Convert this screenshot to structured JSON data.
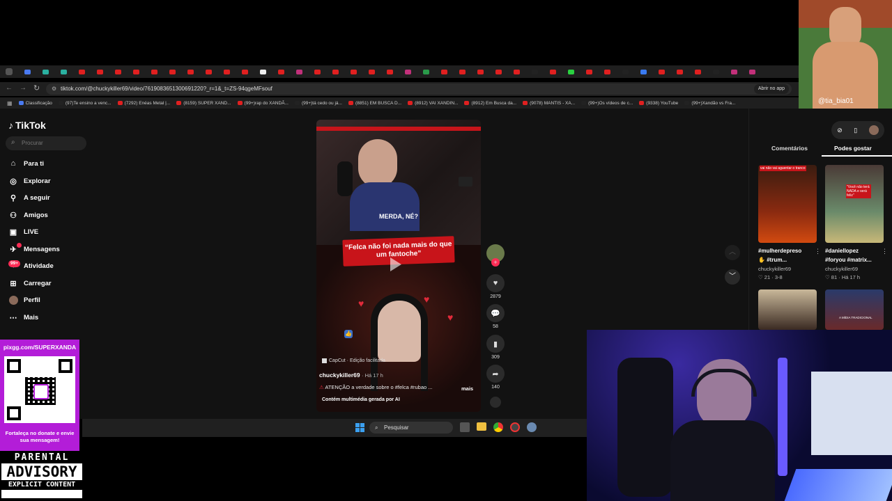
{
  "browser": {
    "url": "tiktok.com/@chuckykiller69/video/7619083651300691220?_r=1&_t=ZS-94qgeMFsouf",
    "open_app_label": "Abrir no app",
    "bookmarks": [
      "Classificação",
      "(97)Te ensino a venc...",
      "(7292) Enéas Metal |...",
      "(8159) SUPER XAND...",
      "(99+)rap do XANDÃ...",
      "(99+)tá cedo ou já...",
      "(8851) EM BUSCA D...",
      "(8912) VAI XANDIN...",
      "(8912) Em Busca da...",
      "(9078) MANTIS - XA...",
      "(99+)Os vídeos de c...",
      "(9338) YouTube",
      "(99+)Xandão vs Fra..."
    ]
  },
  "sidebar": {
    "logo": "TikTok",
    "search_placeholder": "Procurar",
    "items": [
      {
        "label": "Para ti",
        "icon": "home-icon"
      },
      {
        "label": "Explorar",
        "icon": "compass-icon"
      },
      {
        "label": "A seguir",
        "icon": "following-icon"
      },
      {
        "label": "Amigos",
        "icon": "friends-icon"
      },
      {
        "label": "LIVE",
        "icon": "live-icon"
      },
      {
        "label": "Mensagens",
        "icon": "messages-icon"
      },
      {
        "label": "Atividade",
        "icon": "activity-icon",
        "badge": "99+"
      },
      {
        "label": "Carregar",
        "icon": "upload-icon"
      },
      {
        "label": "Perfil",
        "icon": "avatar-icon"
      },
      {
        "label": "Mais",
        "icon": "more-icon"
      }
    ]
  },
  "video": {
    "subtitle": "MERDA, NÉ?",
    "quote": "“Felca não foi nada mais do que um fantoche”",
    "capcut": "CapCut · Edição facilitada",
    "author": "chuckykiller69",
    "time": "· Há 17 h",
    "caption": "ATENÇÃO a verdade sobre o #felca #rubao ...",
    "more": "mais",
    "ai_note": "Contém multimédia gerada por AI",
    "likes": "2879",
    "comments": "58",
    "saves": "309",
    "shares": "140"
  },
  "right_panel": {
    "tab_comments": "Comentários",
    "tab_likes": "Podes gostar",
    "cards": [
      {
        "title": "#mulherdepreso",
        "subtitle": "#trum...",
        "author": "chuckykiller69",
        "stats": "♡ 21 · 3-8",
        "overlay": "vai não vai aguentar o tranco"
      },
      {
        "title": "#daniellopez",
        "subtitle": "#foryou #matrix...",
        "author": "chuckykiller69",
        "stats": "♡ 81 · Há 17 h",
        "overlay": "\"Você não terá NADA e será feliz\""
      },
      {
        "title": "",
        "subtitle": "",
        "author": "",
        "stats": "",
        "overlay": ""
      },
      {
        "title": "",
        "subtitle": "",
        "author": "",
        "stats": "",
        "overlay": "A MÍDIA TRADICIONAL"
      }
    ]
  },
  "taskbar": {
    "search_label": "Pesquisar"
  },
  "donate": {
    "url": "pixgg.com/SUPERXANDA",
    "message": "Fortaleça no donate e envie sua mensagem!"
  },
  "parental": {
    "line1": "PARENTAL",
    "line2": "ADVISORY",
    "line3": "EXPLICIT CONTENT"
  },
  "webcam_top": {
    "watermark": "@tia_bia01"
  },
  "colors": {
    "tiktok_red": "#fe2c55",
    "donate_purple": "#b31dd8",
    "page_bg": "#121212"
  }
}
